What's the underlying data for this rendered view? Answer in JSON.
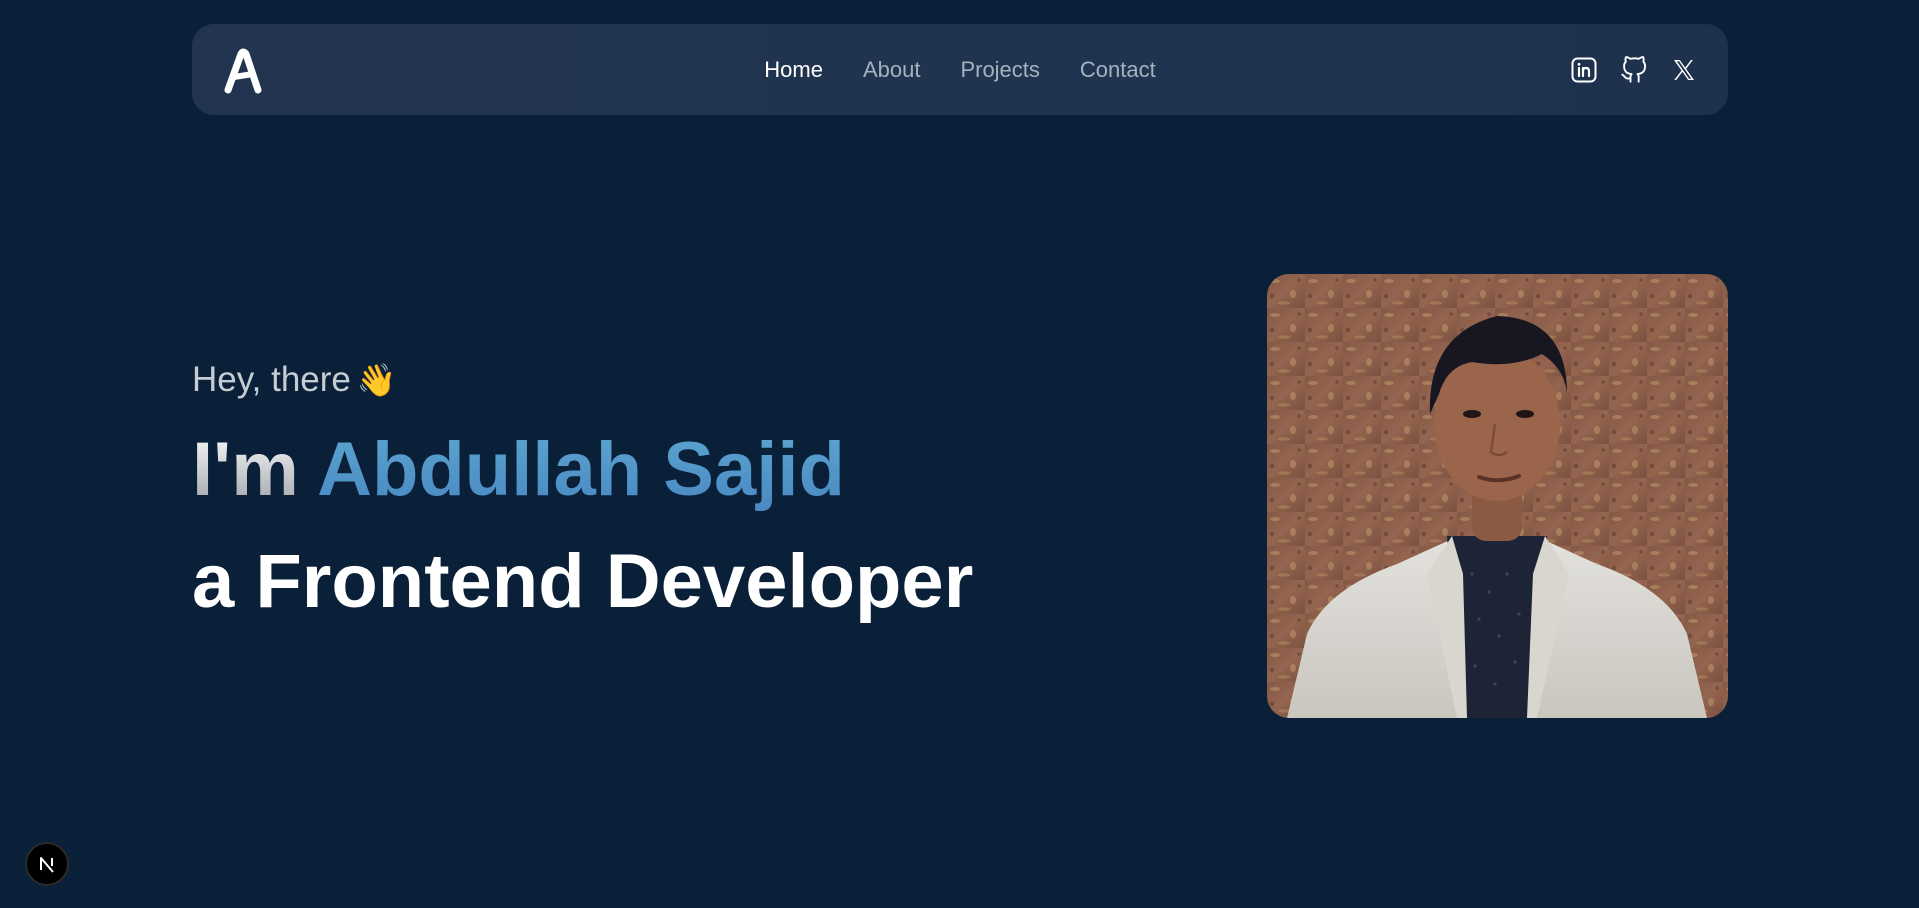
{
  "navbar": {
    "logo_text": "A",
    "links": [
      {
        "label": "Home",
        "active": true
      },
      {
        "label": "About",
        "active": false
      },
      {
        "label": "Projects",
        "active": false
      },
      {
        "label": "Contact",
        "active": false
      }
    ],
    "socials": [
      {
        "icon": "linkedin-icon"
      },
      {
        "icon": "github-icon"
      },
      {
        "icon": "x-twitter-icon"
      }
    ]
  },
  "hero": {
    "greeting": "Hey, there",
    "greeting_emoji": "👋",
    "headline_prefix": "I'm ",
    "headline_name": "Abdullah Sajid",
    "subheadline": "a Frontend Developer",
    "portrait_icon": "profile-photo"
  },
  "dev_badge": {
    "label": "N"
  },
  "colors": {
    "background": "#0a2039",
    "navbar": "#22344f",
    "accent_name": "#4f95c9",
    "nav_inactive": "#a7b0bd"
  }
}
